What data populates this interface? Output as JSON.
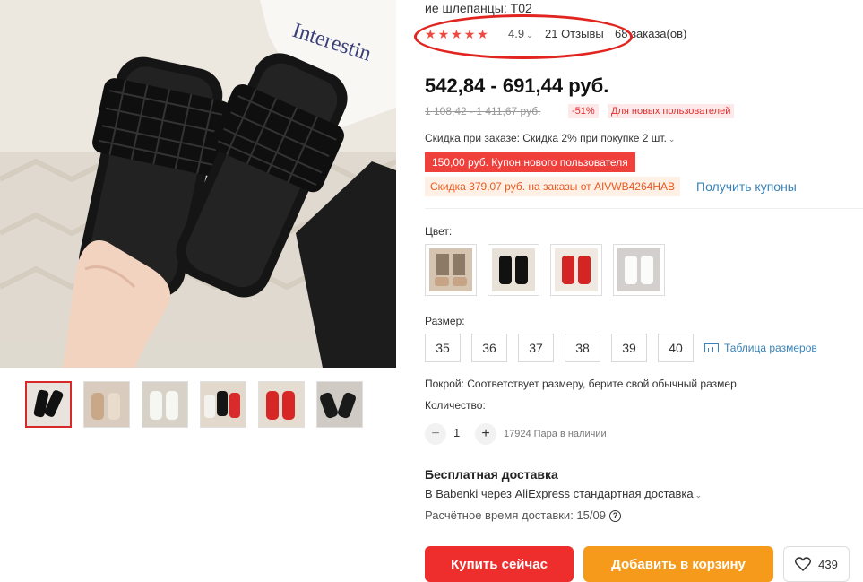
{
  "product": {
    "title_fragment": "ие шлепанцы: T02",
    "rating": "4.9",
    "rating_stars": 5,
    "reviews": "21 Отзывы",
    "orders": "68 заказа(ов)"
  },
  "price": {
    "current": "542,84 - 691,44 руб.",
    "old": "1 108,42 - 1 411,67 руб.",
    "discount": "-51%",
    "new_user_note": "Для новых пользователей"
  },
  "promo": {
    "order_discount": "Скидка при заказе: Скидка 2% при покупке 2 шт.",
    "new_user_coupon": "150,00 руб. Купон нового пользователя",
    "code_discount": "Скидка 379,07 руб. на заказы от AIVWB4264HAB",
    "get_coupons": "Получить купоны"
  },
  "color": {
    "label": "Цвет:",
    "options": [
      "beige-mule",
      "black-woven",
      "red-woven",
      "white-woven"
    ]
  },
  "size": {
    "label": "Размер:",
    "options": [
      "35",
      "36",
      "37",
      "38",
      "39",
      "40"
    ],
    "table_link": "Таблица размеров"
  },
  "fit": "Покрой: Соответствует размеру, берите свой обычный размер",
  "quantity": {
    "label": "Количество:",
    "minus": "−",
    "value": "1",
    "plus": "+",
    "stock": "17924 Пара в наличии"
  },
  "shipping": {
    "title": "Бесплатная доставка",
    "method": "В Babenki через AliExpress стандартная доставка",
    "eta": "Расчётное время доставки: 15/09",
    "help": "?"
  },
  "actions": {
    "buy": "Купить сейчас",
    "cart": "Добавить в корзину",
    "wishlist_count": "439"
  },
  "gallery": {
    "photo_text": "Interestin",
    "thumbnails": 6,
    "active_index": 0
  },
  "colors": {
    "accent_red": "#ee2d2d",
    "cart_orange": "#f59a1b",
    "link_blue": "#3a83b8",
    "annotation_red": "#e1241f"
  }
}
